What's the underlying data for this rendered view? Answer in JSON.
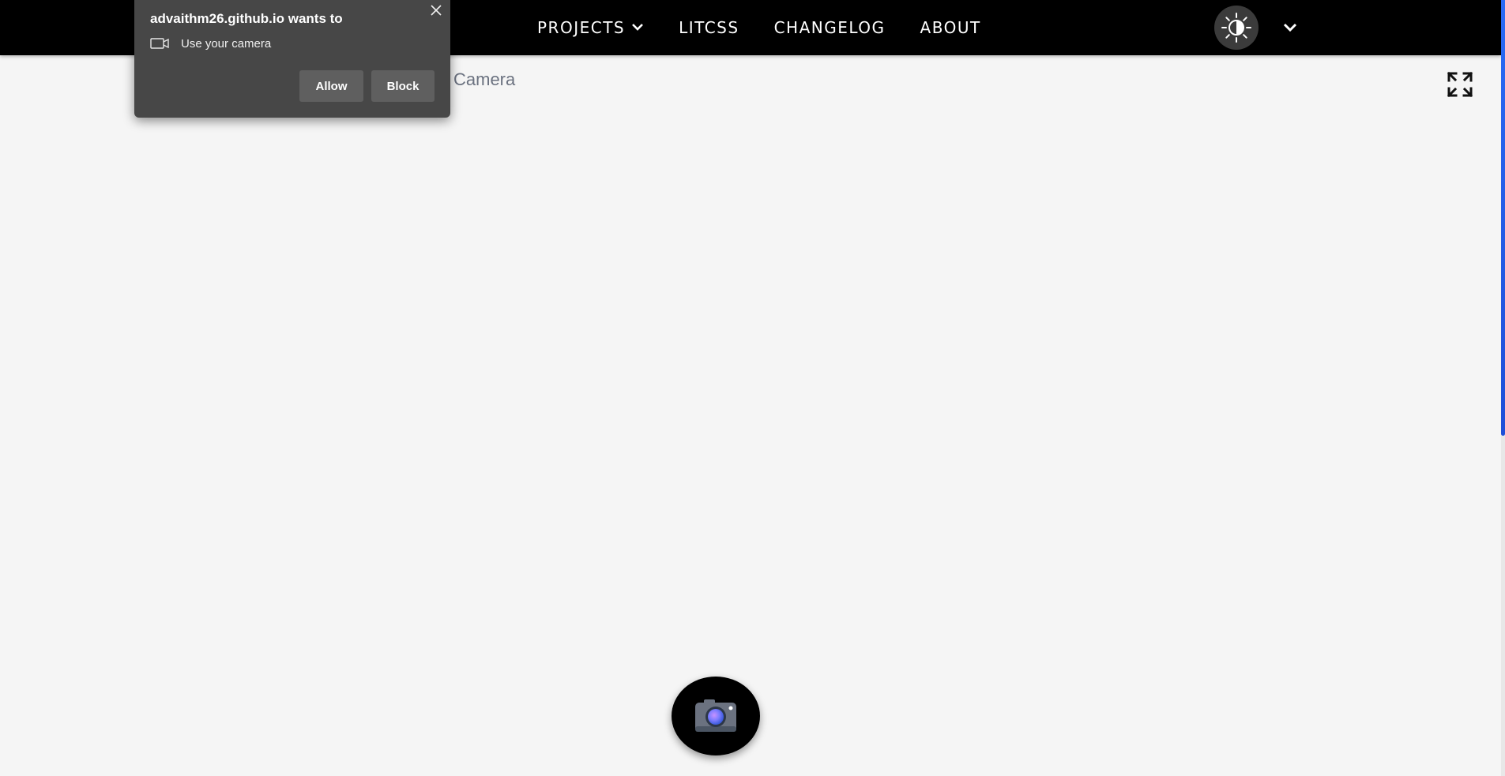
{
  "navbar": {
    "links": [
      {
        "label": "PROJECTS",
        "has_dropdown": true
      },
      {
        "label": "LITCSS"
      },
      {
        "label": "CHANGELOG"
      },
      {
        "label": "ABOUT"
      }
    ],
    "theme_toggle_icon": "brightness-contrast-icon",
    "menu_icon": "chevron-down-icon"
  },
  "main": {
    "title": "Camera",
    "fullscreen_icon": "expand-icon",
    "capture_icon": "camera-icon"
  },
  "permission_popup": {
    "title": "advaithm26.github.io wants to",
    "request_icon": "video-camera-icon",
    "request_label": "Use your camera",
    "allow_label": "Allow",
    "block_label": "Block",
    "close_icon": "close-icon"
  },
  "colors": {
    "navbar_bg": "#000000",
    "page_bg": "#f5f5f5",
    "popup_bg": "#474747",
    "popup_button_bg": "#5f5f5f",
    "title_text": "#6b7280",
    "scrollbar_thumb": "#2a6bf5"
  }
}
